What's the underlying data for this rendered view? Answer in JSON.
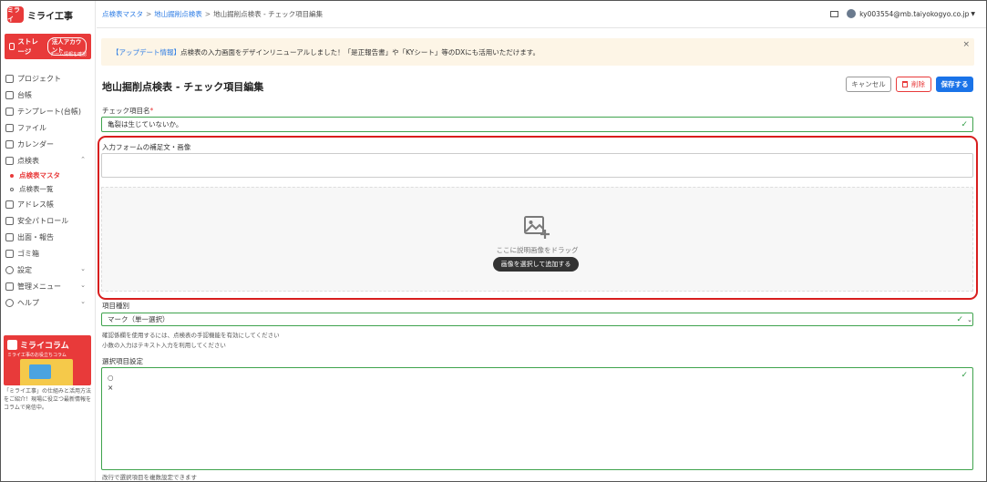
{
  "app": {
    "brand": "ミライ工事",
    "logo_text": "ミライ"
  },
  "sidebar": {
    "storage_label": "ストレージ",
    "storage_badge": "法人アカウント",
    "storage_sub": "チーム情報を確認",
    "items": [
      {
        "label": "プロジェクト",
        "icon": "project-icon"
      },
      {
        "label": "台帳",
        "icon": "ledger-icon"
      },
      {
        "label": "テンプレート(台帳)",
        "icon": "template-icon"
      },
      {
        "label": "ファイル",
        "icon": "file-icon"
      },
      {
        "label": "カレンダー",
        "icon": "calendar-icon"
      },
      {
        "label": "点検表",
        "icon": "checklist-icon"
      },
      {
        "label": "アドレス帳",
        "icon": "address-book-icon"
      },
      {
        "label": "安全パトロール",
        "icon": "patrol-icon"
      },
      {
        "label": "出面・報告",
        "icon": "report-icon"
      },
      {
        "label": "ゴミ箱",
        "icon": "trash-icon"
      },
      {
        "label": "設定",
        "icon": "gear-icon"
      },
      {
        "label": "管理メニュー",
        "icon": "admin-icon"
      },
      {
        "label": "ヘルプ",
        "icon": "help-icon"
      }
    ],
    "sub_items": [
      {
        "label": "点検表マスタ",
        "active": true
      },
      {
        "label": "点検表一覧",
        "active": false
      }
    ],
    "column_title": "ミライコラム",
    "column_sub": "ミライ工事のお役立ちコラム",
    "column_desc": "「ミライ工事」の仕組みと活用方法をご紹介！現場に役立つ最新情報をコラムで発信中。"
  },
  "header": {
    "breadcrumb": [
      "点検表マスタ",
      "地山掘削点検表",
      "地山掘削点検表 - チェック項目編集"
    ],
    "separator": ">",
    "user_email": "ky003554@mb.taiyokogyo.co.jp"
  },
  "banner": {
    "tag": "【アップデート情報】",
    "message": "点検表の入力画面をデザインリニューアルしました！「是正報告書」や「KYシート」等のDXにも活用いただけます。",
    "close": "×"
  },
  "page": {
    "title": "地山掘削点検表 - チェック項目編集",
    "cancel_label": "キャンセル",
    "delete_label": "削除",
    "save_label": "保存する"
  },
  "form": {
    "item_name_label": "チェック項目名",
    "required_mark": "*",
    "item_name_value": "亀裂は生じていないか。",
    "supplement_label": "入力フォームの補足文・画像",
    "drop_text": "ここに説明画像をドラッグ",
    "drop_button": "画像を選択して追加する",
    "type_label": "項目種別",
    "type_value": "マーク（単一選択）",
    "help_1": "確認係欄を使用するには、点検表の手認機能を有効にしてください",
    "help_2": "小数の入力はテキスト入力を利用してください",
    "options_label": "選択項目設定",
    "options": [
      "○",
      "×"
    ],
    "options_help": "改行で選択項目を複数設定できます"
  },
  "colors": {
    "accent": "#e83a3a",
    "primary": "#1a73e8",
    "valid": "#3fa34d"
  }
}
